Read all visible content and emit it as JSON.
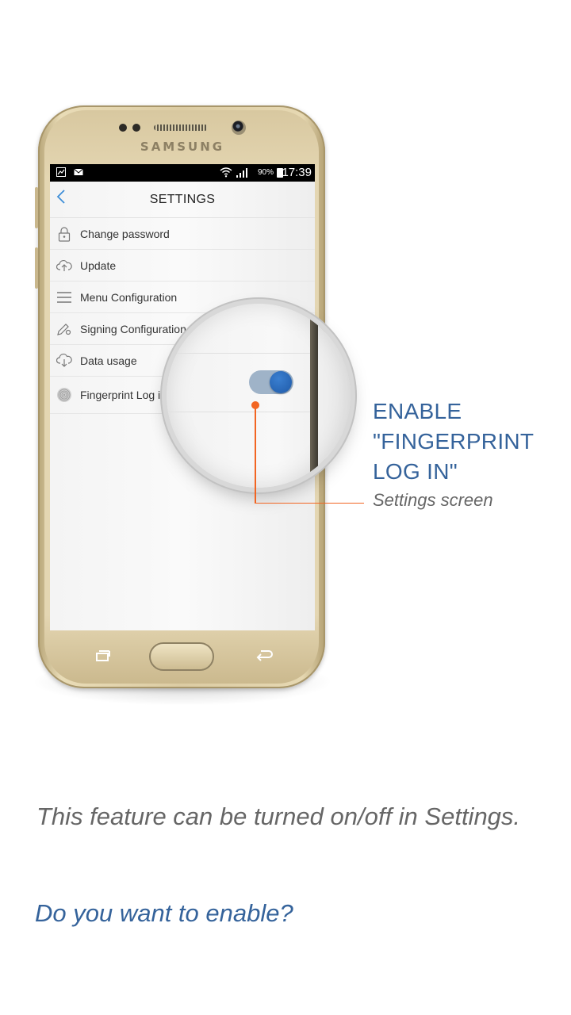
{
  "device": {
    "brand": "SAMSUNG"
  },
  "statusbar": {
    "battery": "90%",
    "time": "17:39"
  },
  "settings": {
    "title": "SETTINGS",
    "items": [
      {
        "label": "Change password",
        "icon": "lock-icon"
      },
      {
        "label": "Update",
        "icon": "cloud-upload-icon"
      },
      {
        "label": "Menu Configuration",
        "icon": "menu-icon"
      },
      {
        "label": "Signing Configuration",
        "icon": "pen-settings-icon"
      },
      {
        "label": "Data usage",
        "icon": "cloud-download-icon"
      },
      {
        "label": "Fingerprint Log in",
        "icon": "fingerprint-icon"
      }
    ],
    "fingerprint_toggle_on": true
  },
  "callout": {
    "title_line1": "ENABLE",
    "title_line2": "\"FINGERPRINT",
    "title_line3": "LOG IN\"",
    "subtitle": "Settings screen"
  },
  "info_text": "This feature can be turned on/off in Settings.",
  "question": "Do you want to enable?",
  "colors": {
    "accent_blue": "#35639b",
    "toggle_blue": "#2a6bbf",
    "callout_orange": "#f26522"
  }
}
